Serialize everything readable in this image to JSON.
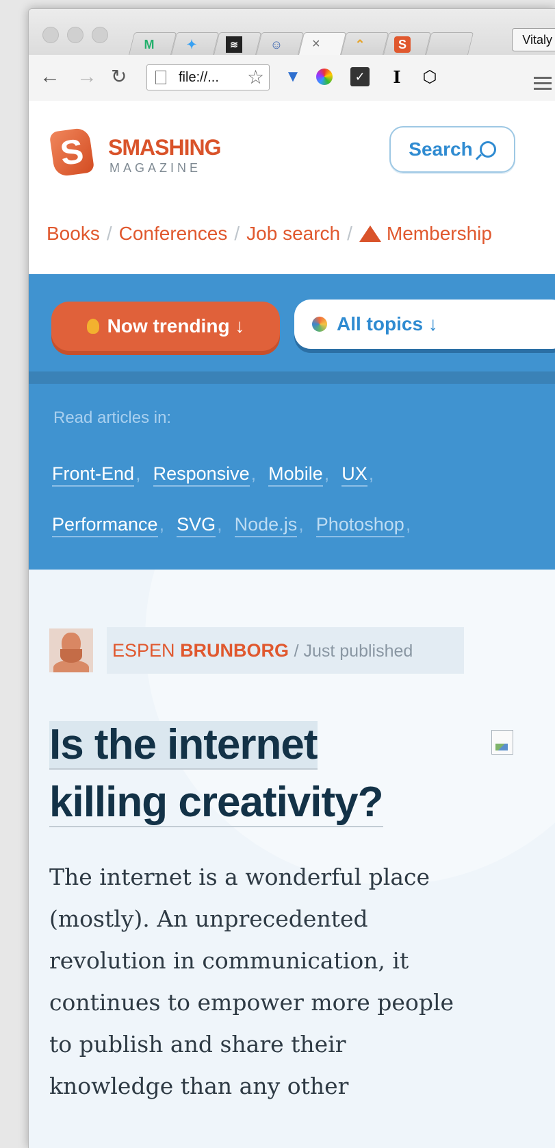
{
  "browser": {
    "profile_name": "Vitaly",
    "address": "file://...",
    "tab_close_glyph": "×"
  },
  "site": {
    "logo_title": "SMASHING",
    "logo_subtitle": "MAGAZINE",
    "logo_letter": "S",
    "search_label": "Search",
    "nav": [
      "Books",
      "Conferences",
      "Job search",
      "Membership"
    ],
    "nav_separator": "/"
  },
  "topics": {
    "trending_label": "Now trending ↓",
    "all_topics_label": "All topics ↓",
    "read_label": "Read articles in:",
    "tags_row1": [
      "Front-End",
      "Responsive",
      "Mobile",
      "UX"
    ],
    "tags_row2": [
      "Performance",
      "SVG",
      "Node.js",
      "Photoshop"
    ],
    "tag_separator": ","
  },
  "article": {
    "author_first": "ESPEN",
    "author_last": "BRUNBORG",
    "byline_note": "/ Just published",
    "headline_line1": "Is the internet",
    "headline_line2": "killing creativity?",
    "excerpt": "The internet is a wonderful place (mostly). An unprecedented revolution in communication, it continues to empower more people to publish and share their knowledge than any other"
  },
  "colors": {
    "brand_orange": "#e0582e",
    "panel_blue": "#4093d0",
    "headline_navy": "#133247"
  }
}
